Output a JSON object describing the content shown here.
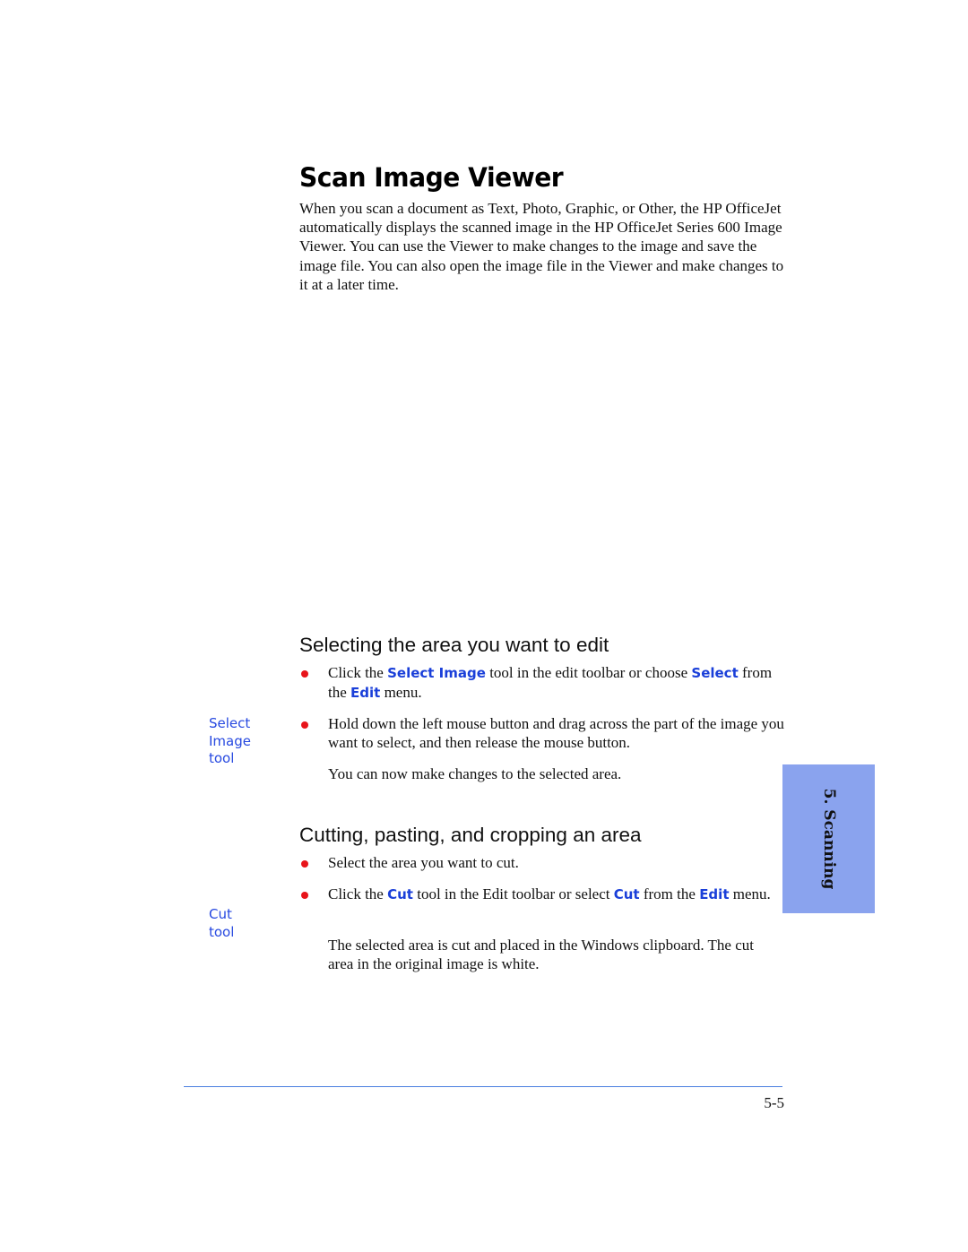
{
  "page": {
    "title": "Scan Image Viewer",
    "intro": "When you scan a document as Text, Photo, Graphic, or Other, the HP OfficeJet automatically displays the scanned image in the HP OfficeJet Series 600 Image Viewer. You can use the Viewer to make changes to the image and save the image file. You can also open the image file in the Viewer and make changes to it at a later time.",
    "accent_color": "#1a3fd9",
    "bullet_color": "#e8141a",
    "tab_color": "#8aa3ee"
  },
  "section1": {
    "heading": "Selecting the area you want to edit",
    "bullet1": {
      "t1": "Click the ",
      "hl1": "Select Image",
      "t2": " tool in the edit toolbar or choose ",
      "hl2": "Select",
      "t3": " from the ",
      "hl3": "Edit",
      "t4": " menu."
    },
    "bullet2": "Hold down the left mouse button and drag across the part of the image you want to select, and then release the mouse button.",
    "note": "You can now make changes to the selected area.",
    "margin_note": [
      "Select",
      "Image",
      "tool"
    ]
  },
  "section2": {
    "heading": "Cutting, pasting, and cropping an area",
    "bullet1": "Select the area you want to cut.",
    "bullet2": {
      "t1": "Click the ",
      "hl1": "Cut",
      "t2": " tool in the Edit toolbar or select ",
      "hl2": "Cut",
      "t3": " from the ",
      "hl3": "Edit",
      "t4": " menu."
    },
    "note": "The selected area is cut and placed in the Windows clipboard. The cut area in the original image is white.",
    "margin_note": [
      "Cut",
      "tool"
    ]
  },
  "side_tab": {
    "label": "5. Scanning"
  },
  "footer": {
    "page_number": "5-5"
  }
}
